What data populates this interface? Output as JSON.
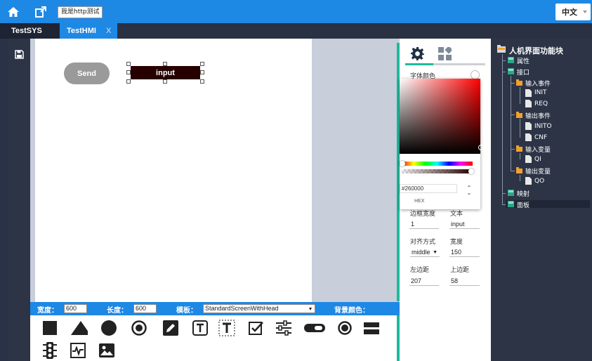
{
  "header": {
    "test_button": "我是http测试",
    "language": "中文"
  },
  "tabs": [
    {
      "label": "TestSYS"
    },
    {
      "label": "TestHMI",
      "close": "X"
    }
  ],
  "canvas": {
    "send_button": "Send",
    "input_element": "input"
  },
  "canvas_settings": {
    "width_label": "宽度：",
    "width_value": "600",
    "height_label": "长度：",
    "height_value": "600",
    "template_label": "模板：",
    "template_value": "StandardScreenWithHead",
    "bg_color_label": "背景颜色："
  },
  "properties": {
    "font_color_label": "字体颜色",
    "border_width_label": "边框宽度",
    "border_width_value": "1",
    "text_label": "文本",
    "text_value": "input",
    "align_label": "对齐方式",
    "align_value": "middle",
    "width_label": "宽度",
    "width_value": "150",
    "left_margin_label": "左边距",
    "left_margin_value": "207",
    "top_margin_label": "上边距",
    "top_margin_value": "58"
  },
  "color_picker": {
    "hex_value": "#260000",
    "mode_label": "HEX"
  },
  "tree": {
    "root": "人机界面功能块",
    "attributes": "属性",
    "interface": "接口",
    "input_events": "输入事件",
    "init": "INIT",
    "req": "REQ",
    "output_events": "输出事件",
    "inito": "INITO",
    "cnf": "CNF",
    "input_vars": "输入变量",
    "qi": "QI",
    "output_vars": "输出变量",
    "qo": "QO",
    "mapping": "映射",
    "panel": "面板"
  },
  "colors": {
    "accent": "#1e88e5",
    "teal": "#1bbc9b",
    "input_bg": "#260000",
    "folder": "#f0a030",
    "leaf_icon": "#2aa889"
  }
}
